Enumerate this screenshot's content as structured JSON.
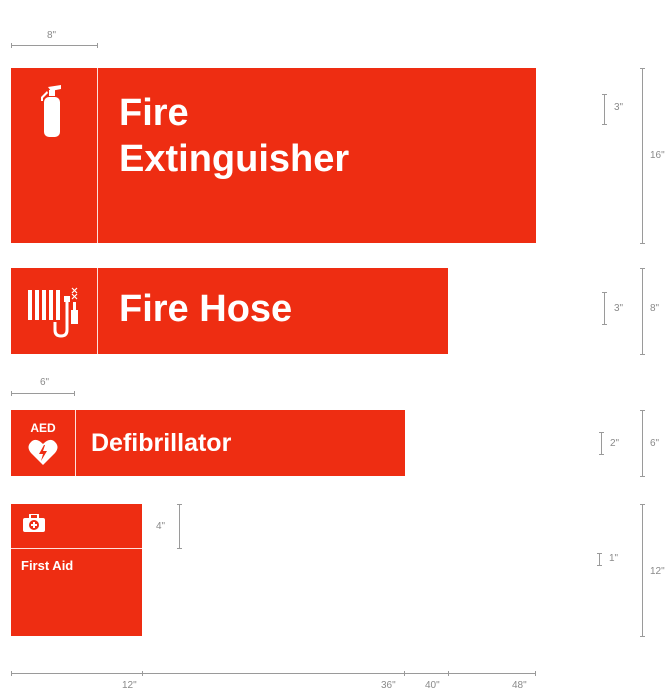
{
  "colors": {
    "sign_red": "#ee2d12",
    "sign_text": "#ffffff",
    "dimension_gray": "#8a8a8a"
  },
  "signs": [
    {
      "title_line1": "Fire",
      "title_line2": "Extinguisher",
      "icon": "fire-extinguisher-icon",
      "letter_height": "3\"",
      "sign_height": "16\""
    },
    {
      "title": "Fire Hose",
      "icon": "fire-hose-icon",
      "letter_height": "3\"",
      "sign_height": "8\""
    },
    {
      "title": "Defibrillator",
      "icon_text": "AED",
      "icon": "aed-heart-icon",
      "letter_height": "2\"",
      "sign_height": "6\""
    },
    {
      "title": "First Aid",
      "icon": "first-aid-kit-icon",
      "panel_height": "4\"",
      "letter_height": "1\"",
      "sign_height": "12\""
    }
  ],
  "dimensions": {
    "top_icon_width": "8\"",
    "aed_icon_width": "6\"",
    "bottom_ruler": [
      "12\"",
      "36\"",
      "40\"",
      "48\""
    ]
  }
}
